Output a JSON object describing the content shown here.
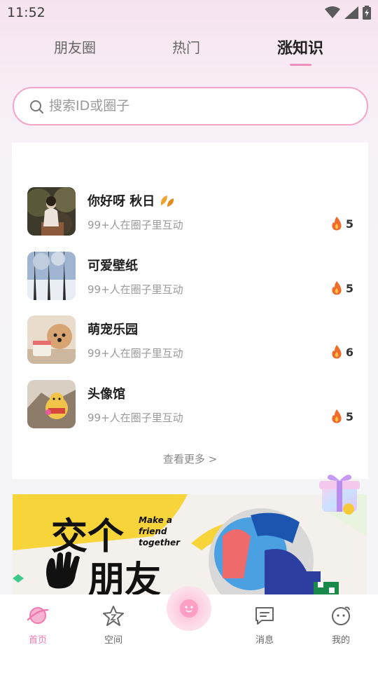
{
  "status": {
    "time": "11:52"
  },
  "tabs": [
    {
      "label": "朋友圈"
    },
    {
      "label": "热门"
    },
    {
      "label": "涨知识"
    }
  ],
  "search": {
    "placeholder": "搜索ID或圈子"
  },
  "circles": [
    {
      "name": "你好呀 秋日",
      "subtitle": "99+人在圈子里互动",
      "heat": "5"
    },
    {
      "name": "可爱壁纸",
      "subtitle": "99+人在圈子里互动",
      "heat": "5"
    },
    {
      "name": "萌宠乐园",
      "subtitle": "99+人在圈子里互动",
      "heat": "6"
    },
    {
      "name": "头像馆",
      "subtitle": "99+人在圈子里互动",
      "heat": "5"
    }
  ],
  "more_label": "查看更多 >",
  "banner": {
    "title_line1": "交个",
    "title_line2": "朋友",
    "en_line1": "Make a",
    "en_line2": "friend",
    "en_line3": "together"
  },
  "nav": [
    {
      "label": "首页",
      "icon": "home-planet-icon",
      "active": true
    },
    {
      "label": "空间",
      "icon": "star-icon",
      "active": false
    },
    {
      "label": "",
      "icon": "center-face-icon",
      "active": false
    },
    {
      "label": "消息",
      "icon": "message-icon",
      "active": false
    },
    {
      "label": "我的",
      "icon": "smiley-icon",
      "active": false
    }
  ],
  "colors": {
    "accent": "#f07ab0",
    "search_border": "#f3a5c6",
    "heat": "#f26a2a"
  }
}
